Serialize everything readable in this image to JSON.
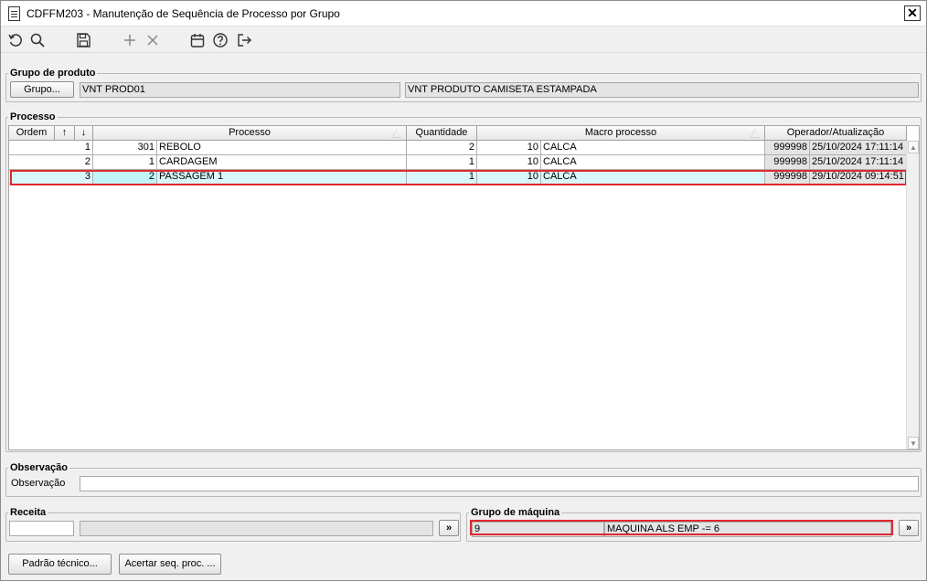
{
  "window": {
    "title": "CDFFM203 - Manutenção de Sequência de Processo por Grupo",
    "close": "✕"
  },
  "toolbar": {
    "icons": [
      "refresh-icon",
      "search-icon",
      "save-icon",
      "add-icon",
      "delete-icon",
      "calendar-icon",
      "help-icon",
      "exit-icon"
    ]
  },
  "grupo_produto": {
    "legend": "Grupo de produto",
    "button_label": "Grupo...",
    "code": "VNT PROD01",
    "description": "VNT PRODUTO CAMISETA ESTAMPADA"
  },
  "processo": {
    "legend": "Processo",
    "columns": {
      "ordem": "Ordem",
      "up": "↑",
      "down": "↓",
      "processo": "Processo",
      "quantidade": "Quantidade",
      "macro": "Macro processo",
      "operador": "Operador/Atualização"
    },
    "rows": [
      {
        "ordem": "1",
        "proc_code": "301",
        "proc_name": "REBOLO",
        "quantidade": "2",
        "macro_code": "10",
        "macro_name": "CALCA",
        "operador": "999998",
        "atualizacao": "25/10/2024 17:11:14"
      },
      {
        "ordem": "2",
        "proc_code": "1",
        "proc_name": "CARDAGEM",
        "quantidade": "1",
        "macro_code": "10",
        "macro_name": "CALCA",
        "operador": "999998",
        "atualizacao": "25/10/2024 17:11:14"
      },
      {
        "ordem": "3",
        "proc_code": "2",
        "proc_name": "PASSAGEM 1",
        "quantidade": "1",
        "macro_code": "10",
        "macro_name": "CALCA",
        "operador": "999998",
        "atualizacao": "29/10/2024 09:14:51"
      }
    ]
  },
  "observacao": {
    "legend": "Observação",
    "label": "Observação",
    "value": ""
  },
  "receita": {
    "legend": "Receita",
    "code": "",
    "description": "",
    "button": "»"
  },
  "grupo_maquina": {
    "legend": "Grupo de máquina",
    "code": "9",
    "description": "MAQUINA ALS EMP -= 6",
    "button": "»"
  },
  "footer": {
    "padrao_tecnico": "Padrão técnico...",
    "acertar": "Acertar seq. proc. ..."
  },
  "colors": {
    "highlight": "#e0282e",
    "selected_row": "#d9f6fb"
  }
}
